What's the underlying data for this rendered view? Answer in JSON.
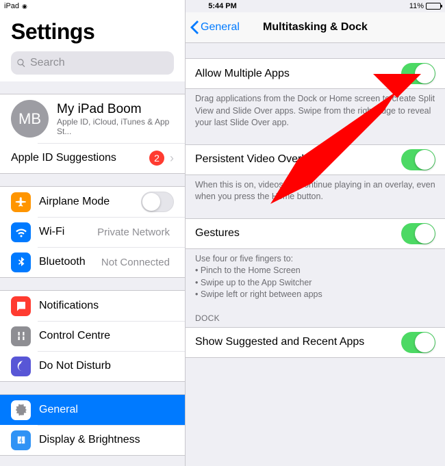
{
  "statusbar": {
    "carrier": "iPad",
    "time": "5:44 PM",
    "battery_text": "11%",
    "battery_pct": 11
  },
  "sidebar": {
    "title": "Settings",
    "search_placeholder": "Search",
    "account": {
      "initials": "MB",
      "name": "My iPad Boom",
      "sub": "Apple ID, iCloud, iTunes & App St..."
    },
    "apple_id_suggestions": {
      "label": "Apple ID Suggestions",
      "badge": "2"
    },
    "airplane": {
      "label": "Airplane Mode",
      "on": false
    },
    "wifi": {
      "label": "Wi-Fi",
      "value": "Private Network"
    },
    "bluetooth": {
      "label": "Bluetooth",
      "value": "Not Connected"
    },
    "notifications": {
      "label": "Notifications"
    },
    "control_centre": {
      "label": "Control Centre"
    },
    "dnd": {
      "label": "Do Not Disturb"
    },
    "general": {
      "label": "General"
    },
    "display": {
      "label": "Display & Brightness"
    }
  },
  "detail": {
    "back_label": "General",
    "title": "Multitasking & Dock",
    "allow": {
      "label": "Allow Multiple Apps",
      "on": true,
      "footer": "Drag applications from the Dock or Home screen to create Split View and Slide Over apps. Swipe from the right edge to reveal your last Slide Over app."
    },
    "pvo": {
      "label": "Persistent Video Overlay",
      "on": true,
      "footer": "When this is on, videos will continue playing in an overlay, even when you press the Home button."
    },
    "gestures": {
      "label": "Gestures",
      "on": true,
      "footer_intro": "Use four or five fingers to:",
      "footer_b1": "• Pinch to the Home Screen",
      "footer_b2": "• Swipe up to the App Switcher",
      "footer_b3": "• Swipe left or right between apps"
    },
    "dock_header": "DOCK",
    "show_suggested": {
      "label": "Show Suggested and Recent Apps",
      "on": true
    }
  }
}
